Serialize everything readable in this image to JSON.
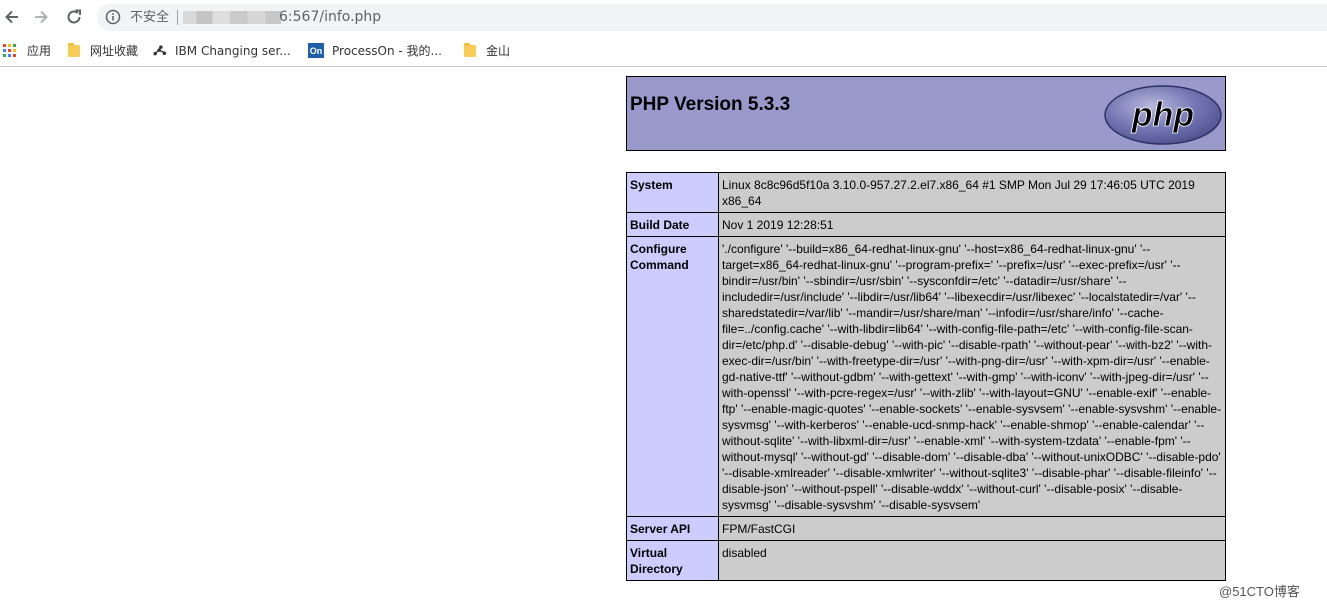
{
  "browser": {
    "security_label": "不安全",
    "url": "6:567/info.php"
  },
  "bookmarks": [
    {
      "label": "应用"
    },
    {
      "label": "网址收藏"
    },
    {
      "label": "IBM Changing ser..."
    },
    {
      "label": "ProcessOn - 我的..."
    },
    {
      "label": "金山"
    }
  ],
  "bookmark_icons": {
    "processon_badge": "On"
  },
  "php": {
    "version_title": "PHP Version 5.3.3",
    "logo_text": "php",
    "rows": [
      {
        "key": "System",
        "value": "Linux 8c8c96d5f10a 3.10.0-957.27.2.el7.x86_64 #1 SMP Mon Jul 29 17:46:05 UTC 2019 x86_64"
      },
      {
        "key": "Build Date",
        "value": "Nov 1 2019 12:28:51"
      },
      {
        "key": "Configure Command",
        "value": "'./configure' '--build=x86_64-redhat-linux-gnu' '--host=x86_64-redhat-linux-gnu' '--target=x86_64-redhat-linux-gnu' '--program-prefix=' '--prefix=/usr' '--exec-prefix=/usr' '--bindir=/usr/bin' '--sbindir=/usr/sbin' '--sysconfdir=/etc' '--datadir=/usr/share' '--includedir=/usr/include' '--libdir=/usr/lib64' '--libexecdir=/usr/libexec' '--localstatedir=/var' '--sharedstatedir=/var/lib' '--mandir=/usr/share/man' '--infodir=/usr/share/info' '--cache-file=../config.cache' '--with-libdir=lib64' '--with-config-file-path=/etc' '--with-config-file-scan-dir=/etc/php.d' '--disable-debug' '--with-pic' '--disable-rpath' '--without-pear' '--with-bz2' '--with-exec-dir=/usr/bin' '--with-freetype-dir=/usr' '--with-png-dir=/usr' '--with-xpm-dir=/usr' '--enable-gd-native-ttf' '--without-gdbm' '--with-gettext' '--with-gmp' '--with-iconv' '--with-jpeg-dir=/usr' '--with-openssl' '--with-pcre-regex=/usr' '--with-zlib' '--with-layout=GNU' '--enable-exif' '--enable-ftp' '--enable-magic-quotes' '--enable-sockets' '--enable-sysvsem' '--enable-sysvshm' '--enable-sysvmsg' '--with-kerberos' '--enable-ucd-snmp-hack' '--enable-shmop' '--enable-calendar' '--without-sqlite' '--with-libxml-dir=/usr' '--enable-xml' '--with-system-tzdata' '--enable-fpm' '--without-mysql' '--without-gd' '--disable-dom' '--disable-dba' '--without-unixODBC' '--disable-pdo' '--disable-xmlreader' '--disable-xmlwriter' '--without-sqlite3' '--disable-phar' '--disable-fileinfo' '--disable-json' '--without-pspell' '--disable-wddx' '--without-curl' '--disable-posix' '--disable-sysvmsg' '--disable-sysvshm' '--disable-sysvsem'"
      },
      {
        "key": "Server API",
        "value": "FPM/FastCGI"
      },
      {
        "key": "Virtual Directory",
        "value": "disabled"
      }
    ]
  },
  "watermark": "@51CTO博客",
  "colors": {
    "header_bg": "#9999cc",
    "key_bg": "#ccccff",
    "value_bg": "#cccccc",
    "apps_grid": [
      "#ea4335",
      "#fbbc05",
      "#34a853",
      "#4285f4"
    ]
  }
}
